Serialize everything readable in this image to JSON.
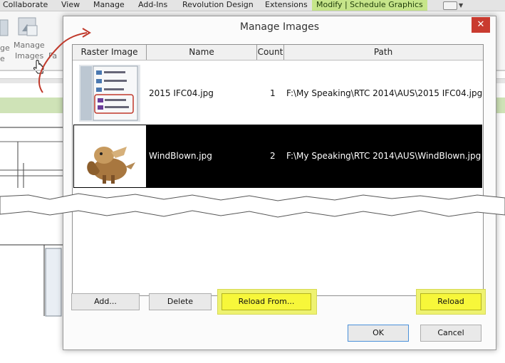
{
  "ribbon": {
    "tabs": [
      "Collaborate",
      "View",
      "Manage",
      "Add-Ins",
      "Revolution Design",
      "Extensions",
      "Modify | Schedule Graphics"
    ],
    "buttons": [
      {
        "label_line1": "ge",
        "label_line2": "e"
      },
      {
        "label_line1": "Manage",
        "label_line2": "Images"
      },
      {
        "label_line1": "",
        "label_line2": "Fa"
      }
    ]
  },
  "dialog": {
    "title": "Manage Images",
    "close_label": "✕",
    "columns": [
      "Raster Image",
      "Name",
      "Count",
      "Path"
    ],
    "rows": [
      {
        "name": "2015 IFC04.jpg",
        "count": "1",
        "path": "F:\\My Speaking\\RTC 2014\\AUS\\2015 IFC04.jpg",
        "selected": false,
        "thumb": "screenshot-thumbnail"
      },
      {
        "name": "WindBlown.jpg",
        "count": "2",
        "path": "F:\\My Speaking\\RTC 2014\\AUS\\WindBlown.jpg",
        "selected": true,
        "thumb": "dog-photo"
      }
    ],
    "buttons": {
      "add": "Add...",
      "delete": "Delete",
      "reload_from": "Reload From...",
      "reload": "Reload",
      "ok": "OK",
      "cancel": "Cancel"
    }
  },
  "colors": {
    "ribbon_active_tab": "#c6e58a",
    "highlight": "#f7f73a",
    "selected_row": "#000000",
    "close_button": "#c93b2f",
    "arrow": "#c0392b"
  }
}
